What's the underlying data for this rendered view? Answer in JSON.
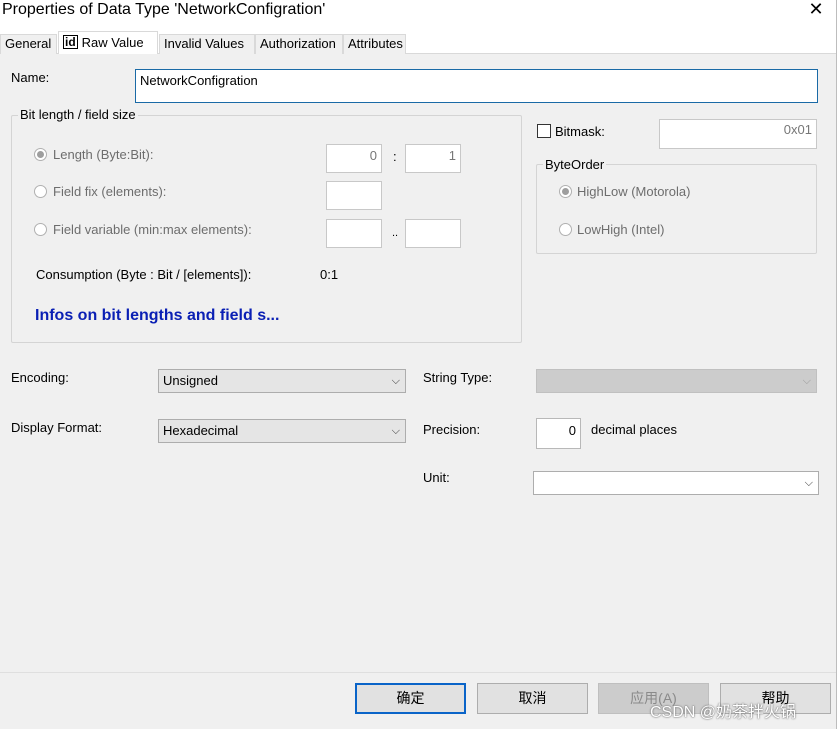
{
  "window": {
    "title": "Properties of Data Type 'NetworkConfigration'",
    "close_glyph": "✕"
  },
  "tabs": [
    {
      "label": "General",
      "active": false
    },
    {
      "label": "Raw Value",
      "icon": "id",
      "active": true
    },
    {
      "label": "Invalid Values",
      "active": false
    },
    {
      "label": "Authorization",
      "active": false
    },
    {
      "label": "Attributes",
      "active": false
    }
  ],
  "name": {
    "label": "Name:",
    "value": "NetworkConfigration"
  },
  "bit_length_group": {
    "title": "Bit length / field size",
    "length": {
      "label": "Length (Byte:Bit):",
      "selected": true,
      "byte": "0",
      "sep": ":",
      "bit": "1"
    },
    "field_fix": {
      "label": "Field fix (elements):",
      "selected": false,
      "value": ""
    },
    "field_variable": {
      "label": "Field variable (min:max elements):",
      "selected": false,
      "min": "",
      "sep": "..",
      "max": ""
    },
    "consumption": {
      "label": "Consumption (Byte : Bit / [elements]):",
      "value": "0:1"
    },
    "info_link": "Infos on bit lengths and field s..."
  },
  "bitmask": {
    "label": "Bitmask:",
    "checked": false,
    "value": "0x01"
  },
  "byte_order": {
    "title": "ByteOrder",
    "options": [
      {
        "label": "HighLow (Motorola)",
        "selected": true
      },
      {
        "label": "LowHigh (Intel)",
        "selected": false
      }
    ]
  },
  "encoding": {
    "label": "Encoding:",
    "value": "Unsigned"
  },
  "display_format": {
    "label": "Display Format:",
    "value": "Hexadecimal"
  },
  "string_type": {
    "label": "String Type:",
    "value": ""
  },
  "precision": {
    "label": "Precision:",
    "value": "0",
    "suffix": "decimal places"
  },
  "unit": {
    "label": "Unit:",
    "value": ""
  },
  "footer": {
    "ok": "确定",
    "cancel": "取消",
    "apply": "应用(A)",
    "help": "帮助"
  },
  "watermark": "CSDN @奶茶拌火锅"
}
